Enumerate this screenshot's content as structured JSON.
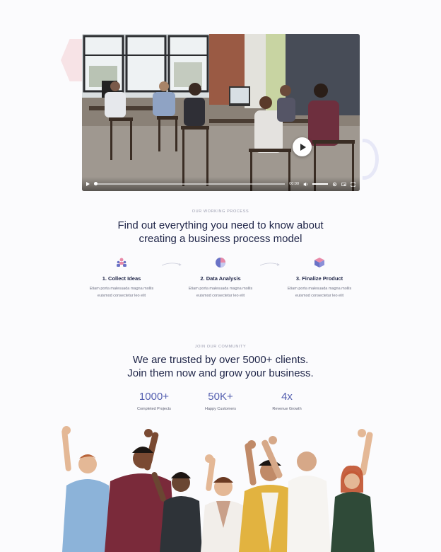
{
  "video": {
    "time": "00:00"
  },
  "process": {
    "eyebrow": "OUR WORKING PROCESS",
    "heading_line1": "Find out everything you need to know about",
    "heading_line2": "creating a business process model",
    "steps": [
      {
        "icon": "people-icon",
        "title": "1. Collect Ideas",
        "desc_line1": "Etiam porta malesuada magna mollis",
        "desc_line2": "euismod consectetur leo elit"
      },
      {
        "icon": "pie-chart-icon",
        "title": "2. Data Analysis",
        "desc_line1": "Etiam porta malesuada magna mollis",
        "desc_line2": "euismod consectetur leo elit"
      },
      {
        "icon": "box-icon",
        "title": "3. Finalize Product",
        "desc_line1": "Etiam porta malesuada magna mollis",
        "desc_line2": "euismod consectetur leo elit"
      }
    ]
  },
  "community": {
    "eyebrow": "JOIN OUR COMMUNITY",
    "heading_line1": "We are trusted by over 5000+ clients.",
    "heading_line2": "Join them now and grow your business.",
    "stats": [
      {
        "value": "1000+",
        "label": "Completed Projects"
      },
      {
        "value": "50K+",
        "label": "Happy Customers"
      },
      {
        "value": "4x",
        "label": "Revenue Growth"
      }
    ]
  },
  "colors": {
    "accent": "#5560b0",
    "heading": "#1f2548",
    "pink": "#e889a8",
    "purple": "#8b8fd8"
  }
}
